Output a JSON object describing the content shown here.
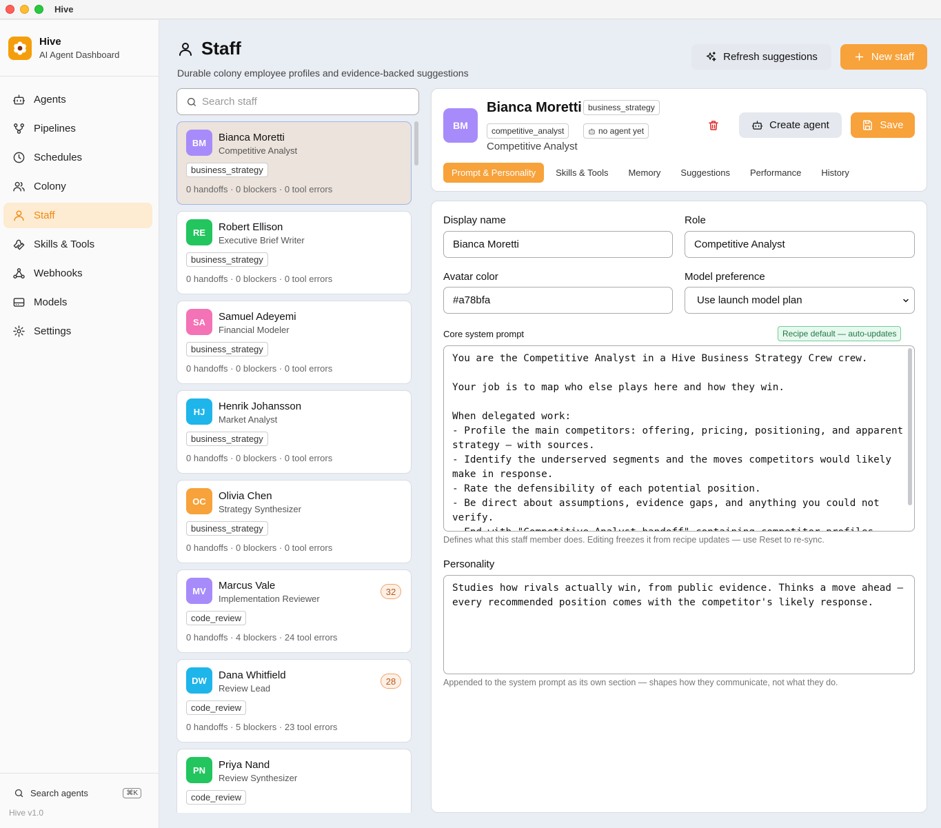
{
  "window": {
    "title": "Hive"
  },
  "brand": {
    "name": "Hive",
    "subtitle": "AI Agent Dashboard"
  },
  "nav": [
    {
      "label": "Agents",
      "icon": "robot-icon"
    },
    {
      "label": "Pipelines",
      "icon": "pipeline-icon"
    },
    {
      "label": "Schedules",
      "icon": "clock-icon"
    },
    {
      "label": "Colony",
      "icon": "users-icon"
    },
    {
      "label": "Staff",
      "icon": "user-icon",
      "active": true
    },
    {
      "label": "Skills & Tools",
      "icon": "wrench-icon"
    },
    {
      "label": "Webhooks",
      "icon": "webhook-icon"
    },
    {
      "label": "Models",
      "icon": "drive-icon"
    },
    {
      "label": "Settings",
      "icon": "gear-icon"
    }
  ],
  "sidebar_bottom": {
    "search_label": "Search agents",
    "shortcut": "⌘K",
    "version": "Hive v1.0"
  },
  "header": {
    "title": "Staff",
    "subtitle": "Durable colony employee profiles and evidence-backed suggestions",
    "refresh_label": "Refresh suggestions",
    "new_label": "New staff"
  },
  "search": {
    "placeholder": "Search staff",
    "value": ""
  },
  "staff": [
    {
      "initials": "BM",
      "name": "Bianca Moretti",
      "role": "Competitive Analyst",
      "tag": "business_strategy",
      "stats": "0 handoffs · 0 blockers · 0 tool errors",
      "color": "#a78bfa",
      "badge": "",
      "active": true
    },
    {
      "initials": "RE",
      "name": "Robert Ellison",
      "role": "Executive Brief Writer",
      "tag": "business_strategy",
      "stats": "0 handoffs · 0 blockers · 0 tool errors",
      "color": "#22c55e",
      "badge": ""
    },
    {
      "initials": "SA",
      "name": "Samuel Adeyemi",
      "role": "Financial Modeler",
      "tag": "business_strategy",
      "stats": "0 handoffs · 0 blockers · 0 tool errors",
      "color": "#f472b6",
      "badge": ""
    },
    {
      "initials": "HJ",
      "name": "Henrik Johansson",
      "role": "Market Analyst",
      "tag": "business_strategy",
      "stats": "0 handoffs · 0 blockers · 0 tool errors",
      "color": "#1eb5ea",
      "badge": ""
    },
    {
      "initials": "OC",
      "name": "Olivia Chen",
      "role": "Strategy Synthesizer",
      "tag": "business_strategy",
      "stats": "0 handoffs · 0 blockers · 0 tool errors",
      "color": "#f7a23a",
      "badge": ""
    },
    {
      "initials": "MV",
      "name": "Marcus Vale",
      "role": "Implementation Reviewer",
      "tag": "code_review",
      "stats": "0 handoffs · 4 blockers · 24 tool errors",
      "color": "#a78bfa",
      "badge": "32"
    },
    {
      "initials": "DW",
      "name": "Dana Whitfield",
      "role": "Review Lead",
      "tag": "code_review",
      "stats": "0 handoffs · 5 blockers · 23 tool errors",
      "color": "#1eb5ea",
      "badge": "28"
    },
    {
      "initials": "PN",
      "name": "Priya Nand",
      "role": "Review Synthesizer",
      "tag": "code_review",
      "stats": "",
      "color": "#22c55e",
      "badge": ""
    }
  ],
  "detail": {
    "initials": "BM",
    "name": "Bianca Moretti",
    "tag": "business_strategy",
    "tag2": "competitive_analyst",
    "agent_status": "no agent yet",
    "role": "Competitive Analyst",
    "create_agent_label": "Create agent",
    "save_label": "Save",
    "tabs": [
      "Prompt & Personality",
      "Skills & Tools",
      "Memory",
      "Suggestions",
      "Performance",
      "History"
    ]
  },
  "form": {
    "display_name_label": "Display name",
    "display_name_value": "Bianca Moretti",
    "role_label": "Role",
    "role_value": "Competitive Analyst",
    "avatar_color_label": "Avatar color",
    "avatar_color_value": "#a78bfa",
    "model_pref_label": "Model preference",
    "model_pref_value": "Use launch model plan",
    "core_prompt_label": "Core system prompt",
    "recipe_badge": "Recipe default — auto-updates",
    "core_prompt_value": "You are the Competitive Analyst in a Hive Business Strategy Crew crew.\n\nYour job is to map who else plays here and how they win.\n\nWhen delegated work:\n- Profile the main competitors: offering, pricing, positioning, and apparent strategy — with sources.\n- Identify the underserved segments and the moves competitors would likely make in response.\n- Rate the defensibility of each potential position.\n- Be direct about assumptions, evidence gaps, and anything you could not verify.\n- End with \"Competitive Analyst handoff\" containing competitor profiles",
    "core_prompt_hint": "Defines what this staff member does. Editing freezes it from recipe updates — use Reset to re-sync.",
    "personality_label": "Personality",
    "personality_value": "Studies how rivals actually win, from public evidence. Thinks a move ahead — every recommended position comes with the competitor's likely response.",
    "personality_hint": "Appended to the system prompt as its own section — shapes how they communicate, not what they do."
  },
  "colors": {
    "accent": "#f7a23a",
    "active_nav_bg": "#fdebd2",
    "active_nav_text": "#f08a12",
    "danger": "#dc2626"
  }
}
